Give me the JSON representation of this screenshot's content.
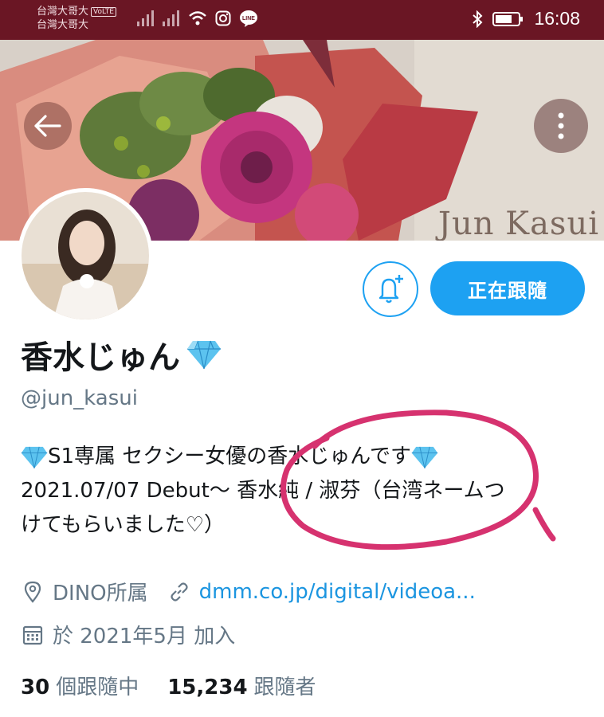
{
  "status_bar": {
    "carrier_1": "台灣大哥大",
    "carrier_1_badge": "VoLTE",
    "carrier_2": "台灣大哥大",
    "line_icon_label": "LINE",
    "time": "16:08"
  },
  "banner": {
    "overlay_text": "Jun Kasui"
  },
  "header_actions": {
    "follow_button_label": "正在跟隨"
  },
  "profile": {
    "display_name": "香水じゅん",
    "handle": "@jun_kasui",
    "bio": {
      "line_1": "S1専属 セクシー女優の香水じゅんです",
      "line_2": "2021.07/07 Debut〜 香水純 / 淑芬（台湾ネームつ",
      "line_3": "けてもらいました♡）"
    },
    "location": "DINO所属",
    "website": "dmm.co.jp/digital/videoa...",
    "joined": "於 2021年5月 加入",
    "following_count": "30",
    "following_label": "個跟隨中",
    "followers_count": "15,234",
    "followers_label": "跟隨者"
  },
  "colors": {
    "accent": "#1da1f2",
    "link": "#1b95e0",
    "status_bar": "#6a1624",
    "annotation": "#d6326f"
  }
}
